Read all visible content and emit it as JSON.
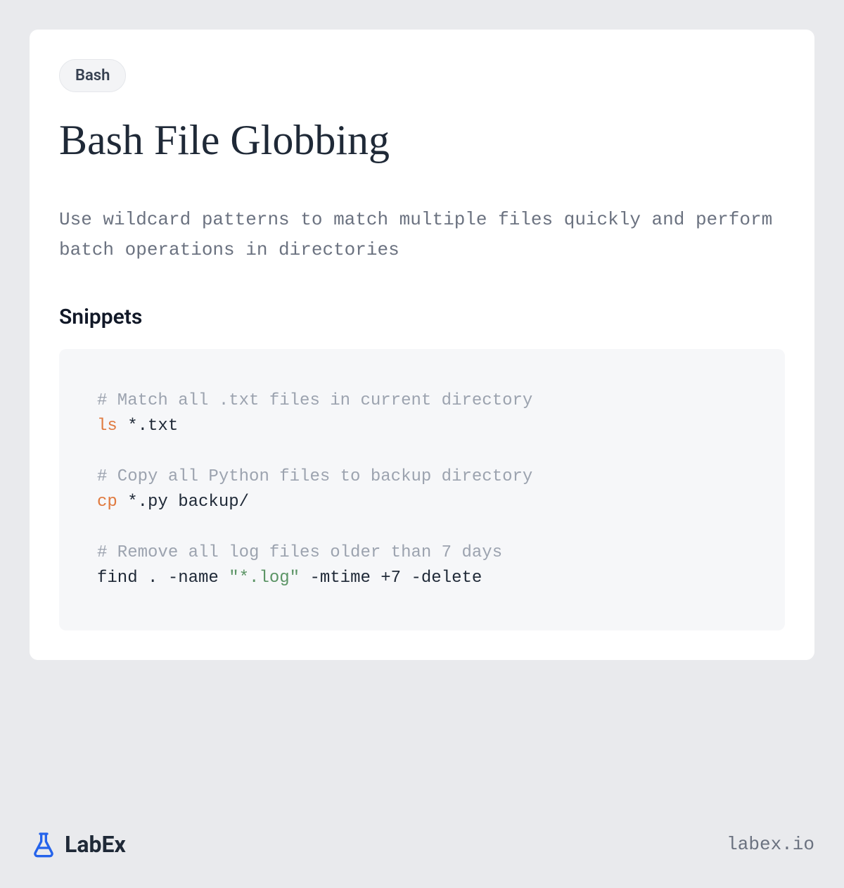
{
  "tag": "Bash",
  "title": "Bash File Globbing",
  "description": "Use wildcard patterns to match multiple files quickly and perform batch operations in directories",
  "snippets_heading": "Snippets",
  "code": {
    "tokens": [
      {
        "type": "comment",
        "text": "# Match all .txt files in current directory"
      },
      {
        "type": "newline"
      },
      {
        "type": "cmd",
        "text": "ls"
      },
      {
        "type": "plain",
        "text": " *.txt"
      },
      {
        "type": "newline"
      },
      {
        "type": "newline"
      },
      {
        "type": "comment",
        "text": "# Copy all Python files to backup directory"
      },
      {
        "type": "newline"
      },
      {
        "type": "cmd",
        "text": "cp"
      },
      {
        "type": "plain",
        "text": " *.py backup/"
      },
      {
        "type": "newline"
      },
      {
        "type": "newline"
      },
      {
        "type": "comment",
        "text": "# Remove all log files older than 7 days"
      },
      {
        "type": "newline"
      },
      {
        "type": "plain",
        "text": "find . -name "
      },
      {
        "type": "string",
        "text": "\"*.log\""
      },
      {
        "type": "plain",
        "text": " -mtime +7 -delete"
      }
    ]
  },
  "footer": {
    "brand": "LabEx",
    "url": "labex.io"
  }
}
